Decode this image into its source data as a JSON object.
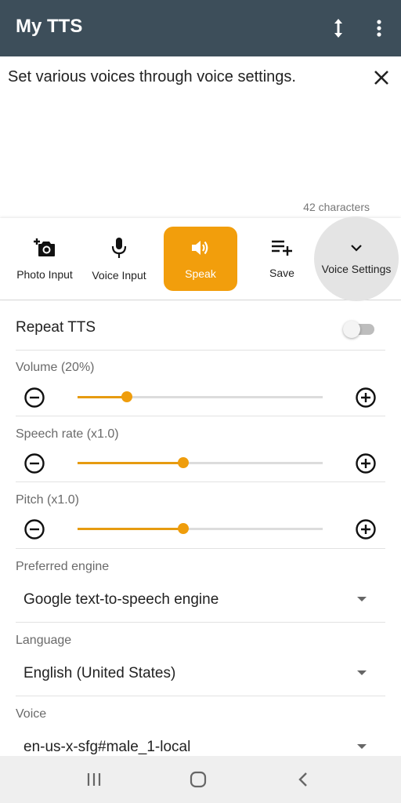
{
  "app": {
    "title": "My TTS"
  },
  "input": {
    "text": "Set various voices through voice settings.",
    "count_label": "42 characters"
  },
  "toolbar": {
    "photo_label": "Photo Input",
    "voice_input_label": "Voice Input",
    "speak_label": "Speak",
    "save_label": "Save",
    "voice_settings_label": "Voice Settings"
  },
  "settings": {
    "repeat": {
      "label": "Repeat TTS",
      "enabled": false
    },
    "volume": {
      "label": "Volume (20%)",
      "value": 0.2
    },
    "speech_rate": {
      "label": "Speech rate (x1.0)",
      "value": 0.43
    },
    "pitch": {
      "label": "Pitch (x1.0)",
      "value": 0.43
    },
    "engine": {
      "label": "Preferred engine",
      "value": "Google text-to-speech engine"
    },
    "language": {
      "label": "Language",
      "value": "English (United States)"
    },
    "voice": {
      "label": "Voice",
      "value": "en-us-x-sfg#male_1-local"
    }
  },
  "colors": {
    "appbar": "#3d4e5a",
    "accent": "#f29e0c"
  },
  "icons": [
    "resize-vertical-icon",
    "more-vert-icon",
    "close-icon",
    "add-photo-icon",
    "mic-icon",
    "volume-icon",
    "playlist-add-icon",
    "chevron-down-icon",
    "minus-circle-icon",
    "plus-circle-icon",
    "recents-icon",
    "home-icon",
    "back-icon"
  ]
}
